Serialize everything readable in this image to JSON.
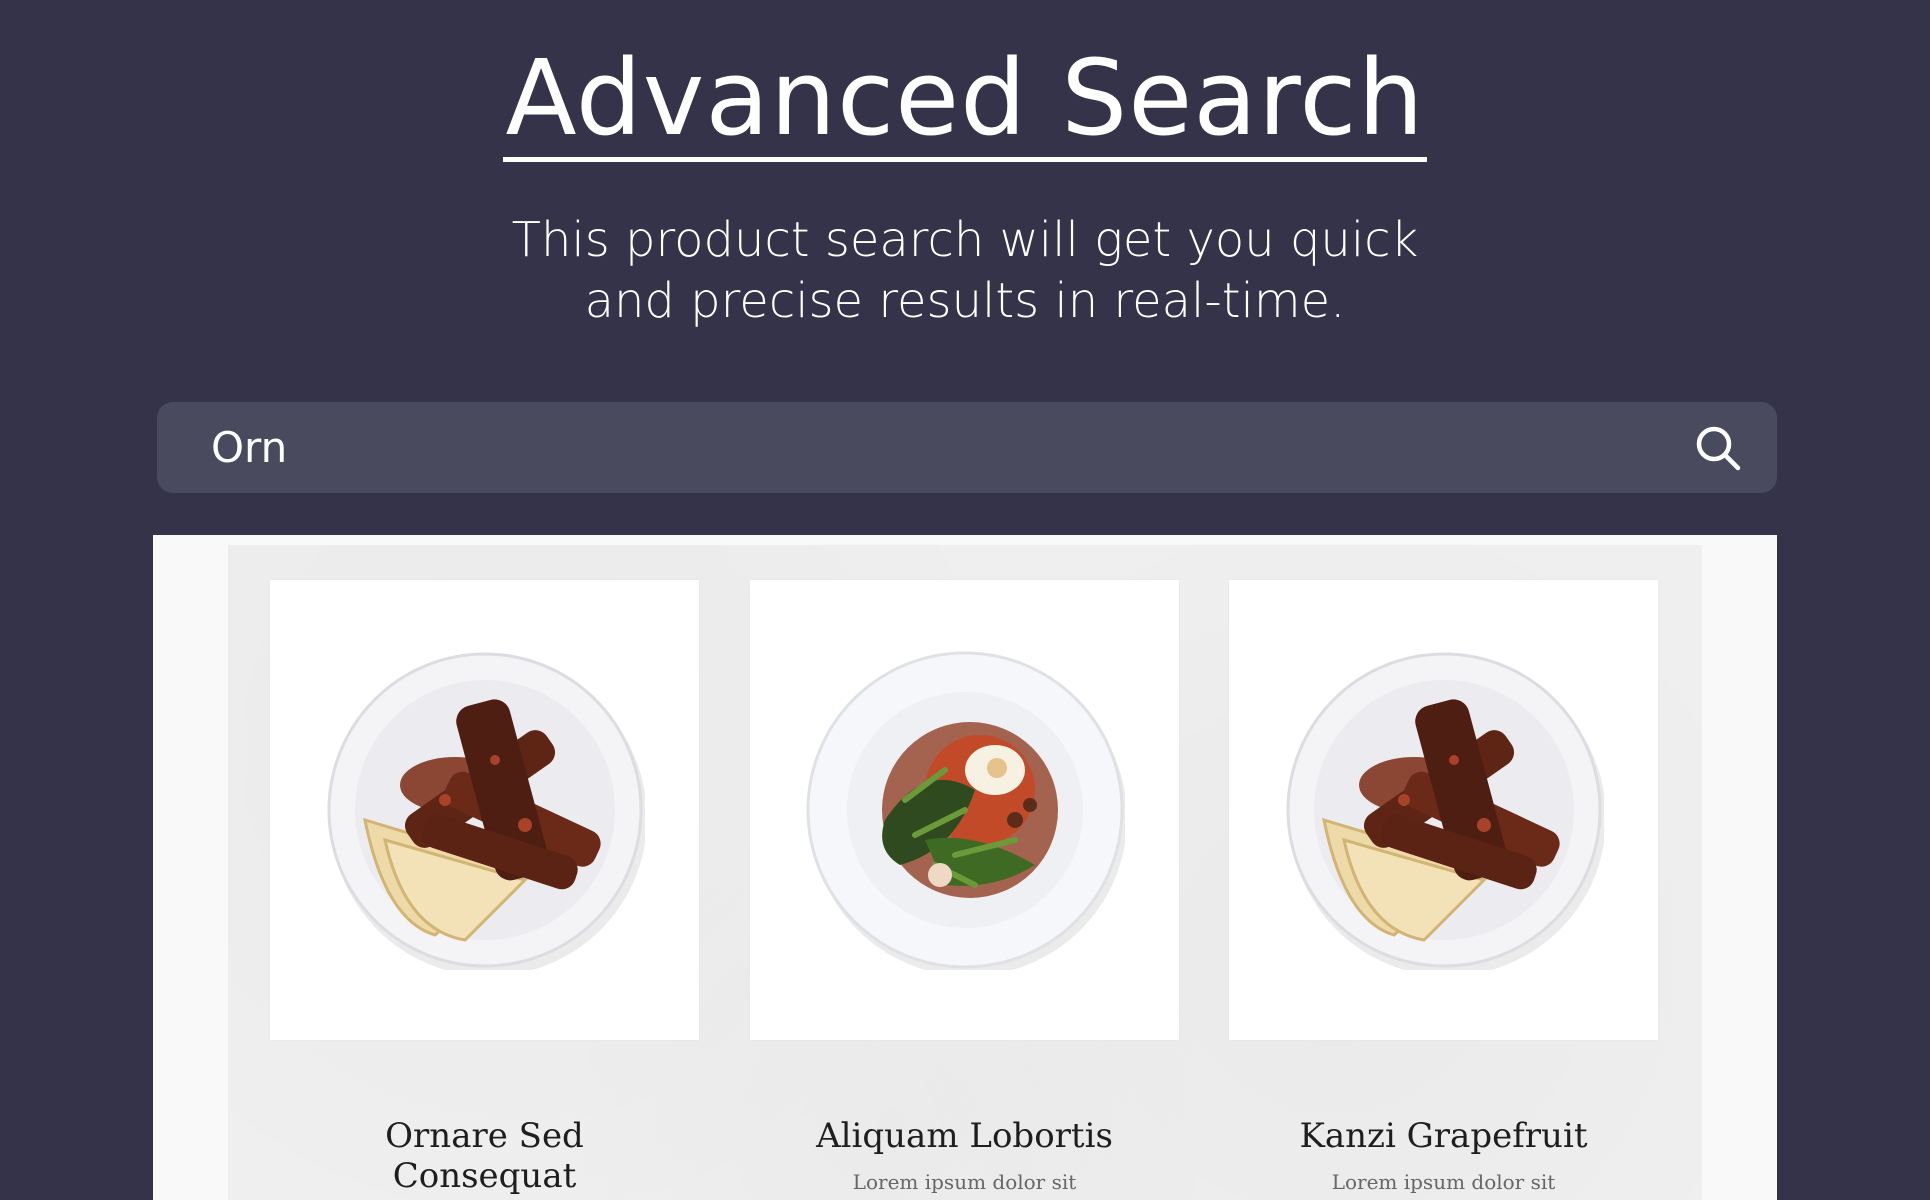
{
  "header": {
    "title": "Advanced Search",
    "subtitle": "This product search will get you quick and precise results in real-time."
  },
  "search": {
    "value": "Orn",
    "icon": "search-icon"
  },
  "colors": {
    "background": "#35334a",
    "search_bar": "#4a4a5e",
    "results_panel": "#f9f9f9",
    "text_light": "#ffffff",
    "text_dark": "#1e1e1e"
  },
  "results": [
    {
      "name": "Ornare Sed Consequat",
      "image": "ribs-plate",
      "description": ""
    },
    {
      "name": "Aliquam Lobortis",
      "image": "salad-egg-plate",
      "description": "Lorem ipsum dolor sit"
    },
    {
      "name": "Kanzi Grapefruit",
      "image": "ribs-plate",
      "description": "Lorem ipsum dolor sit"
    }
  ]
}
